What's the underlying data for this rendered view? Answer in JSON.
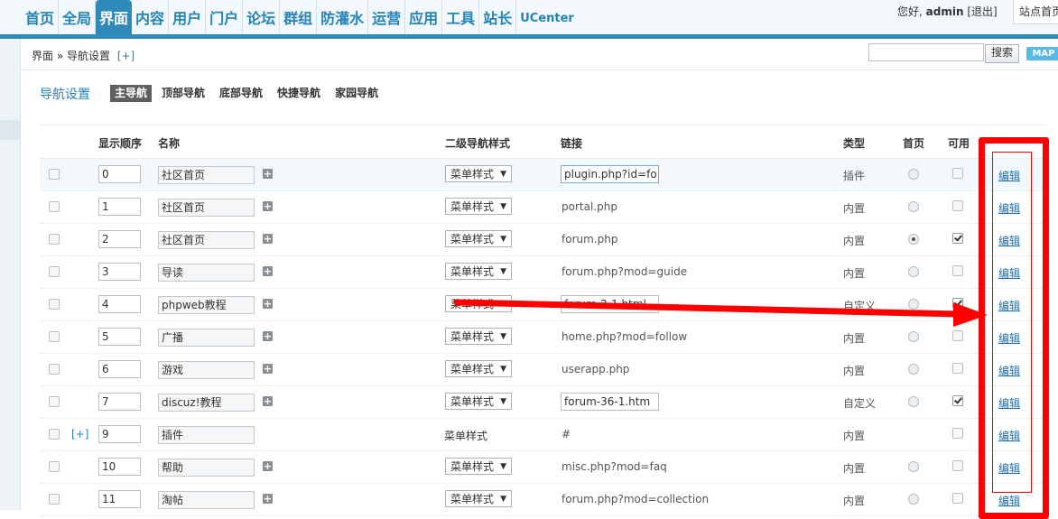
{
  "header": {
    "nav": [
      "首页",
      "全局",
      "界面",
      "内容",
      "用户",
      "门户",
      "论坛",
      "群组",
      "防灌水",
      "运营",
      "应用",
      "工具",
      "站长",
      "UCenter"
    ],
    "active_nav": "界面",
    "greeting": "您好,",
    "username": "admin",
    "logout": "[退出]",
    "site_home": "站点首页"
  },
  "breadcrumb": {
    "text": "界面 » 导航设置",
    "add": "[+]"
  },
  "search": {
    "value": "",
    "button": "搜索",
    "map": "MAP"
  },
  "page": {
    "title": "导航设置",
    "tabs": [
      "主导航",
      "顶部导航",
      "底部导航",
      "快捷导航",
      "家园导航"
    ],
    "active_tab": "主导航"
  },
  "table": {
    "headers": {
      "order": "显示顺序",
      "name": "名称",
      "sub_style": "二级导航样式",
      "link": "链接",
      "type": "类型",
      "home": "首页",
      "enabled": "可用"
    },
    "edit_label": "编辑",
    "add_label": "[+]",
    "rows": [
      {
        "checked": false,
        "order": "0",
        "name": "社区首页",
        "style": "菜单样式",
        "link": "plugin.php?id=fo",
        "link_editable": true,
        "type": "插件",
        "home": false,
        "enabled": false
      },
      {
        "checked": false,
        "order": "1",
        "name": "社区首页",
        "style": "菜单样式",
        "link": "portal.php",
        "link_editable": false,
        "type": "内置",
        "home": false,
        "enabled": false
      },
      {
        "checked": false,
        "order": "2",
        "name": "社区首页",
        "style": "菜单样式",
        "link": "forum.php",
        "link_editable": false,
        "type": "内置",
        "home": true,
        "enabled": true
      },
      {
        "checked": false,
        "order": "3",
        "name": "导读",
        "style": "菜单样式",
        "link": "forum.php?mod=guide",
        "link_editable": false,
        "type": "内置",
        "home": false,
        "enabled": false
      },
      {
        "checked": false,
        "order": "4",
        "name": "phpweb教程",
        "style": "菜单样式",
        "link": "forum-2-1.html",
        "link_editable": true,
        "type": "自定义",
        "home": false,
        "enabled": true
      },
      {
        "checked": false,
        "order": "5",
        "name": "广播",
        "style": "菜单样式",
        "link": "home.php?mod=follow",
        "link_editable": false,
        "type": "内置",
        "home": false,
        "enabled": false
      },
      {
        "checked": false,
        "order": "6",
        "name": "游戏",
        "style": "菜单样式",
        "link": "userapp.php",
        "link_editable": false,
        "type": "内置",
        "home": false,
        "enabled": false
      },
      {
        "checked": false,
        "order": "7",
        "name": "discuz!教程",
        "style": "菜单样式",
        "link": "forum-36-1.htm",
        "link_editable": true,
        "type": "自定义",
        "home": false,
        "enabled": true
      },
      {
        "checked": false,
        "order": "9",
        "name": "插件",
        "style": "菜单样式",
        "link": "#",
        "link_editable": false,
        "type": "内置",
        "home": null,
        "enabled": false,
        "is_parent": true
      },
      {
        "checked": false,
        "order": "10",
        "name": "帮助",
        "style": "菜单样式",
        "link": "misc.php?mod=faq",
        "link_editable": false,
        "type": "内置",
        "home": false,
        "enabled": false
      },
      {
        "checked": false,
        "order": "11",
        "name": "淘帖",
        "style": "菜单样式",
        "link": "forum.php?mod=collection",
        "link_editable": false,
        "type": "内置",
        "home": false,
        "enabled": false
      }
    ]
  },
  "colors": {
    "accent": "#2f8ab9",
    "annotation": "#ff0000"
  }
}
